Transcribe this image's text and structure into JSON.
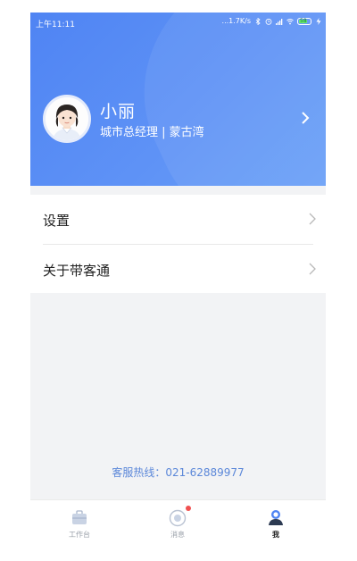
{
  "status_bar": {
    "time": "上午11:11",
    "network_speed": "...1.7K/s",
    "battery_level": "58"
  },
  "profile": {
    "name": "小丽",
    "role": "城市总经理 | 蒙古湾"
  },
  "menu": {
    "items": [
      {
        "label": "设置"
      },
      {
        "label": "关于带客通"
      }
    ]
  },
  "hotline": "客服热线：021-62889977",
  "tabbar": {
    "tabs": [
      {
        "label": "工作台",
        "icon": "briefcase-icon"
      },
      {
        "label": "消息",
        "icon": "message-icon"
      },
      {
        "label": "我",
        "icon": "profile-icon"
      }
    ],
    "active_tab": "我"
  },
  "colors": {
    "header_blue": "#4f84f3",
    "hotline_blue": "#5b87d9",
    "badge_red": "#f05050"
  }
}
